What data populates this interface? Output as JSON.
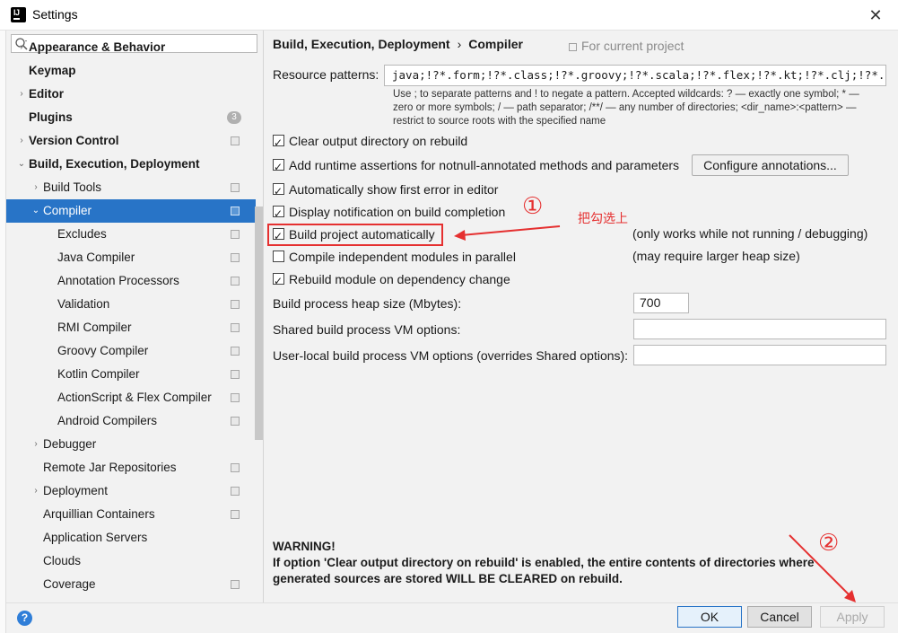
{
  "window": {
    "title": "Settings"
  },
  "search": {
    "placeholder": ""
  },
  "sidebar": {
    "items": [
      {
        "label": "Appearance & Behavior",
        "bold": true,
        "arrow": "›",
        "project": false
      },
      {
        "label": "Keymap",
        "bold": true,
        "arrow": "",
        "project": false
      },
      {
        "label": "Editor",
        "bold": true,
        "arrow": "›",
        "project": false
      },
      {
        "label": "Plugins",
        "bold": true,
        "arrow": "",
        "badge": "3"
      },
      {
        "label": "Version Control",
        "bold": true,
        "arrow": "›",
        "project": true
      },
      {
        "label": "Build, Execution, Deployment",
        "bold": true,
        "arrow": "⌄",
        "project": false
      },
      {
        "label": "Build Tools",
        "bold": false,
        "arrow": "›",
        "project": true
      },
      {
        "label": "Compiler",
        "bold": false,
        "arrow": "⌄",
        "project": true,
        "selected": true
      },
      {
        "label": "Excludes",
        "bold": false,
        "arrow": "",
        "project": true
      },
      {
        "label": "Java Compiler",
        "bold": false,
        "arrow": "",
        "project": true
      },
      {
        "label": "Annotation Processors",
        "bold": false,
        "arrow": "",
        "project": true
      },
      {
        "label": "Validation",
        "bold": false,
        "arrow": "",
        "project": true
      },
      {
        "label": "RMI Compiler",
        "bold": false,
        "arrow": "",
        "project": true
      },
      {
        "label": "Groovy Compiler",
        "bold": false,
        "arrow": "",
        "project": true
      },
      {
        "label": "Kotlin Compiler",
        "bold": false,
        "arrow": "",
        "project": true
      },
      {
        "label": "ActionScript & Flex Compiler",
        "bold": false,
        "arrow": "",
        "project": true
      },
      {
        "label": "Android Compilers",
        "bold": false,
        "arrow": "",
        "project": true
      },
      {
        "label": "Debugger",
        "bold": false,
        "arrow": "›",
        "project": false
      },
      {
        "label": "Remote Jar Repositories",
        "bold": false,
        "arrow": "",
        "project": true
      },
      {
        "label": "Deployment",
        "bold": false,
        "arrow": "›",
        "project": true
      },
      {
        "label": "Arquillian Containers",
        "bold": false,
        "arrow": "",
        "project": true
      },
      {
        "label": "Application Servers",
        "bold": false,
        "arrow": "",
        "project": false
      },
      {
        "label": "Clouds",
        "bold": false,
        "arrow": "",
        "project": false
      },
      {
        "label": "Coverage",
        "bold": false,
        "arrow": "",
        "project": true
      }
    ]
  },
  "breadcrumb": {
    "parent": "Build, Execution, Deployment",
    "sep": "›",
    "current": "Compiler"
  },
  "for_project": "For current project",
  "resource": {
    "label": "Resource patterns:",
    "value": "java;!?*.form;!?*.class;!?*.groovy;!?*.scala;!?*.flex;!?*.kt;!?*.clj;!?*.aj",
    "hint": "Use ; to separate patterns and ! to negate a pattern. Accepted wildcards: ? — exactly one symbol; * — zero or more symbols; / — path separator; /**/ — any number of directories; <dir_name>:<pattern> — restrict to source roots with the specified name"
  },
  "options": [
    {
      "label": "Clear output directory on rebuild",
      "checked": true
    },
    {
      "label": "Add runtime assertions for notnull-annotated methods and parameters",
      "checked": true
    },
    {
      "label": "Automatically show first error in editor",
      "checked": true
    },
    {
      "label": "Display notification on build completion",
      "checked": true
    },
    {
      "label": "Build project automatically",
      "checked": true,
      "note": "(only works while not running / debugging)"
    },
    {
      "label": "Compile independent modules in parallel",
      "checked": false,
      "note": "(may require larger heap size)"
    },
    {
      "label": "Rebuild module on dependency change",
      "checked": true
    }
  ],
  "configure_button": "Configure annotations...",
  "heap": {
    "label": "Build process heap size (Mbytes):",
    "value": "700"
  },
  "shared_vm": {
    "label": "Shared build process VM options:",
    "value": ""
  },
  "user_vm": {
    "label": "User-local build process VM options (overrides Shared options):",
    "value": ""
  },
  "warning": {
    "title": "WARNING!",
    "text": "If option 'Clear output directory on rebuild' is enabled, the entire contents of directories where generated sources are stored WILL BE CLEARED on rebuild."
  },
  "footer": {
    "ok": "OK",
    "cancel": "Cancel",
    "apply": "Apply",
    "help": "?"
  },
  "annotations": {
    "step1": "①",
    "step1_note": "把勾选上",
    "step2": "②",
    "color": "#e53030"
  },
  "colors": {
    "selection": "#2874c7",
    "window_bg": "#f2f2f2"
  },
  "icons": {
    "check": "check-icon",
    "project": "project-level-icon"
  }
}
